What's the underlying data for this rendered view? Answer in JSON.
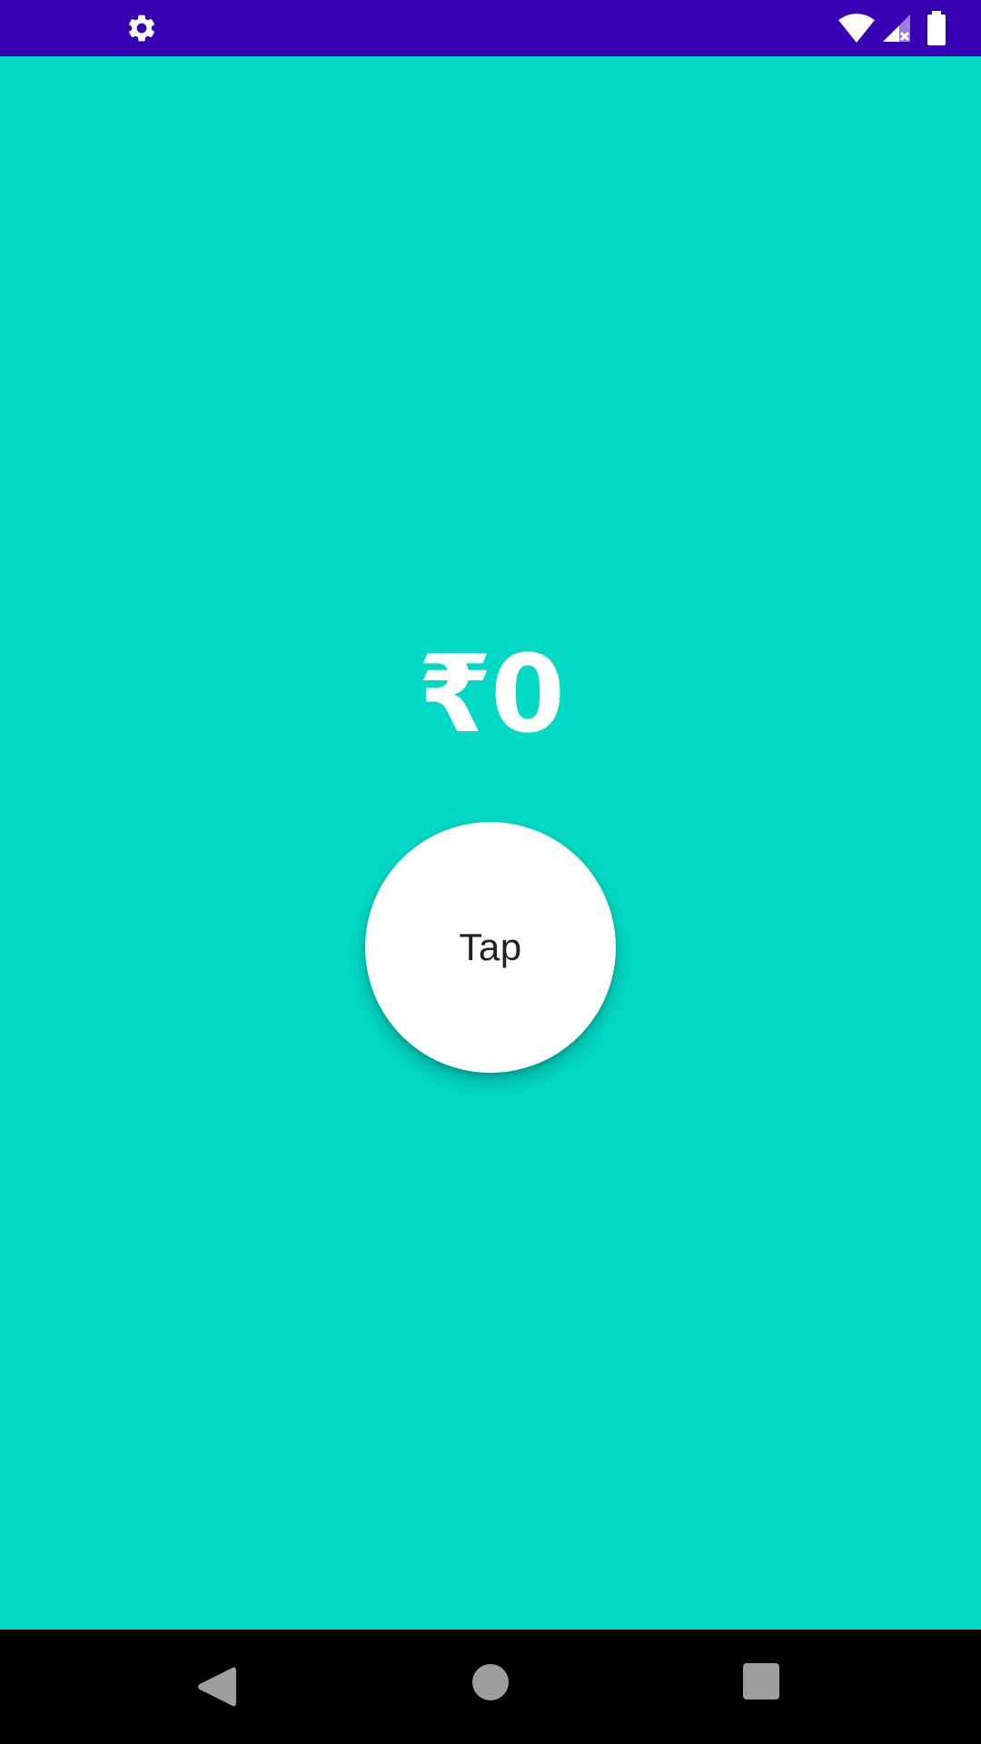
{
  "status_bar": {
    "left_icon": "gear-icon",
    "right_icons": [
      "wifi-icon",
      "cell-signal-no-data-icon",
      "battery-icon"
    ],
    "background_color": "#3700B3"
  },
  "main": {
    "background_color": "#03DAC5",
    "amount_text": "₹0",
    "tap_button_label": "Tap"
  },
  "nav_bar": {
    "icons": [
      "back-icon",
      "home-icon",
      "recents-icon"
    ]
  }
}
